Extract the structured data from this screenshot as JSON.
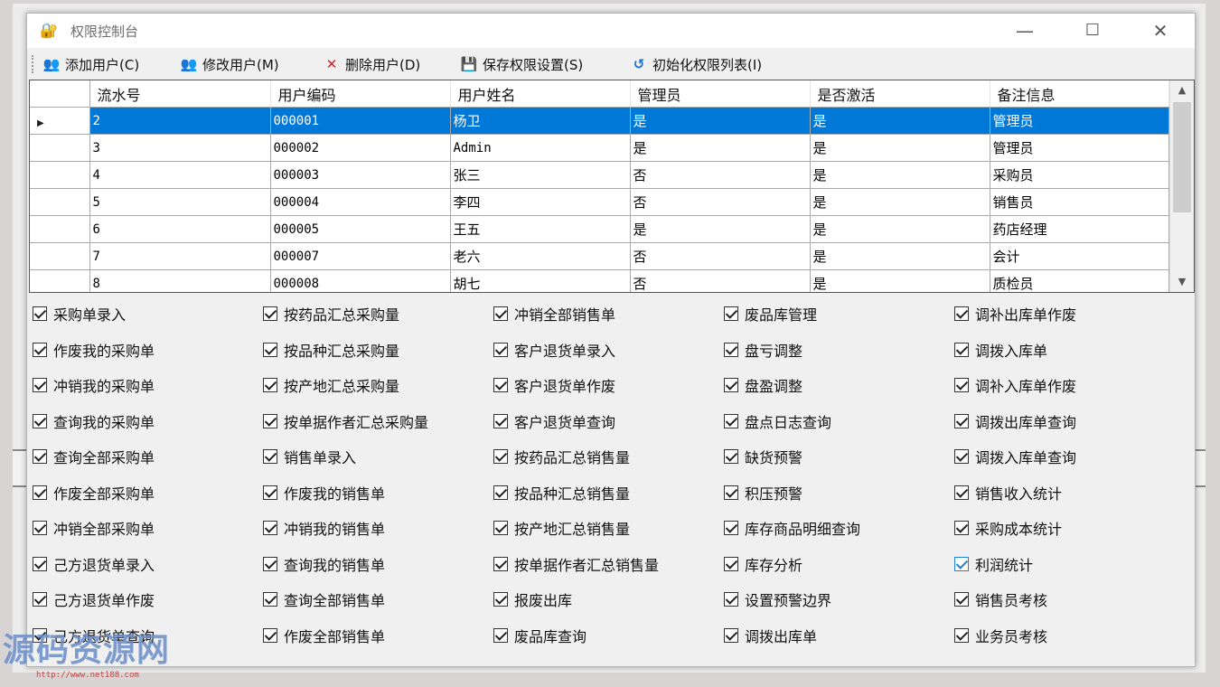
{
  "window": {
    "title": "权限控制台",
    "minimize": "—",
    "maximize": "☐",
    "close": "✕"
  },
  "toolbar": {
    "buttons": [
      {
        "label": "添加用户(C)",
        "icon": "add-user-icon"
      },
      {
        "label": "修改用户(M)",
        "icon": "edit-user-icon"
      },
      {
        "label": "删除用户(D)",
        "icon": "delete-icon"
      },
      {
        "label": "保存权限设置(S)",
        "icon": "save-icon"
      },
      {
        "label": "初始化权限列表(I)",
        "icon": "refresh-icon"
      }
    ]
  },
  "grid": {
    "columns": [
      "流水号",
      "用户编码",
      "用户姓名",
      "管理员",
      "是否激活",
      "备注信息"
    ],
    "rows": [
      [
        "2",
        "000001",
        "杨卫",
        "是",
        "是",
        "管理员"
      ],
      [
        "3",
        "000002",
        "Admin",
        "是",
        "是",
        "管理员"
      ],
      [
        "4",
        "000003",
        "张三",
        "否",
        "是",
        "采购员"
      ],
      [
        "5",
        "000004",
        "李四",
        "否",
        "是",
        "销售员"
      ],
      [
        "6",
        "000005",
        "王五",
        "是",
        "是",
        "药店经理"
      ],
      [
        "7",
        "000007",
        "老六",
        "否",
        "是",
        "会计"
      ],
      [
        "8",
        "000008",
        "胡七",
        "否",
        "是",
        "质检员"
      ]
    ],
    "selected_row": 0
  },
  "permissions": {
    "columns": [
      [
        "采购单录入",
        "作废我的采购单",
        "冲销我的采购单",
        "查询我的采购单",
        "查询全部采购单",
        "作废全部采购单",
        "冲销全部采购单",
        "己方退货单录入",
        "己方退货单作废",
        "己方退货单查询"
      ],
      [
        "按药品汇总采购量",
        "按品种汇总采购量",
        "按产地汇总采购量",
        "按单据作者汇总采购量",
        "销售单录入",
        "作废我的销售单",
        "冲销我的销售单",
        "查询我的销售单",
        "查询全部销售单",
        "作废全部销售单"
      ],
      [
        "冲销全部销售单",
        "客户退货单录入",
        "客户退货单作废",
        "客户退货单查询",
        "按药品汇总销售量",
        "按品种汇总销售量",
        "按产地汇总销售量",
        "按单据作者汇总销售量",
        "报废出库",
        "废品库查询"
      ],
      [
        "废品库管理",
        "盘亏调整",
        "盘盈调整",
        "盘点日志查询",
        "缺货预警",
        "积压预警",
        "库存商品明细查询",
        "库存分析",
        "设置预警边界",
        "调拨出库单"
      ],
      [
        "调补出库单作废",
        "调拨入库单",
        "调补入库单作废",
        "调拨出库单查询",
        "调拨入库单查询",
        "销售收入统计",
        "采购成本统计",
        "利润统计",
        "销售员考核",
        "业务员考核"
      ]
    ],
    "all_checked": true,
    "highlighted": "利润统计"
  },
  "watermark": {
    "text": "源码资源网",
    "url": "http://www.net188.com"
  }
}
